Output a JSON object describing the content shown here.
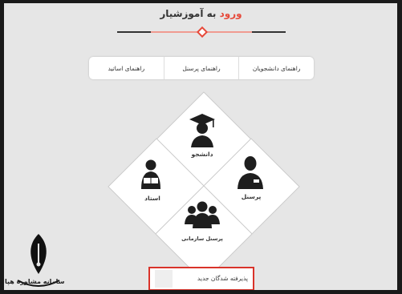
{
  "header": {
    "title_accent": "ورود",
    "title_rest": " به آموزشیار"
  },
  "tabs": [
    {
      "label": "راهنمای دانشجویان"
    },
    {
      "label": "راهنمای پرسنل"
    },
    {
      "label": "راهنمای اساتید"
    }
  ],
  "tiles": {
    "student": {
      "label": "دانشجو",
      "icon": "graduate-icon"
    },
    "staff": {
      "label": "پرسنل",
      "icon": "employee-icon"
    },
    "professor": {
      "label": "استاد",
      "icon": "teacher-icon"
    },
    "organization_staff": {
      "label": "پرسنل سازمانی",
      "icon": "group-icon"
    }
  },
  "new_accepted": {
    "label": "پذیرفته شدگان جدید"
  },
  "watermark": {
    "text": "سامانه مشاوره هپا",
    "icon": "pen-nib-logo"
  },
  "colors": {
    "accent": "#e64a3b",
    "highlight_border": "#d9332a"
  }
}
